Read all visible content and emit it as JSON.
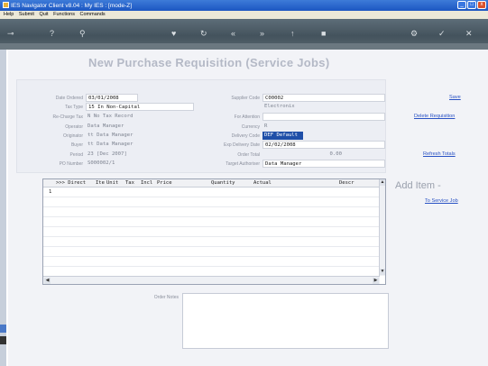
{
  "window": {
    "title": "IES Navigator Client v8.04 : My IES :     [mode-Z]",
    "controls": [
      "_",
      "□",
      "x"
    ]
  },
  "menu": [
    "Help",
    "Submit",
    "Quit",
    "Functions",
    "Commands"
  ],
  "toolbar_icons": [
    "key-icon",
    "help-icon",
    "search-icon",
    "heart-icon",
    "reload-icon",
    "back-icon",
    "forward-icon",
    "up-icon",
    "stop-icon",
    "settings-icon",
    "check-icon",
    "close-icon"
  ],
  "form": {
    "title": "New Purchase Requisition (Service Jobs)",
    "labels": {
      "date_ordered": "Date Ordered",
      "tax_type": "Tax Type",
      "recharge_tax": "Re-Charge Tax",
      "operator": "Operator",
      "originator": "Originator",
      "buyer": "Buyer",
      "period": "Period",
      "po_number": "PO Number",
      "supplier_code": "Supplier Code",
      "for_attention": "For Attention",
      "currency": "Currency",
      "delivery_code": "Delivery Code",
      "exp_delivery_date": "Exp Delivery Date",
      "order_total": "Order Total",
      "target_authoriser": "Target Authoriser"
    },
    "values": {
      "date_ordered": "03/01/2008",
      "tax_type": "15 In Non-Capital",
      "recharge_tax": "N No Tax Record",
      "operator": "Data Manager",
      "originator": "tt Data Manager",
      "buyer": "tt Data Manager",
      "period": "23  [Dec 2007]",
      "po_number": "S000002/1",
      "supplier_code": "C00002",
      "supplier_name": "Electronix",
      "for_attention": "",
      "currency": "R",
      "delivery_code": "DEF Default",
      "exp_delivery_date": "02/02/2008",
      "order_total": "0.00",
      "target_authoriser": "Data Manager"
    }
  },
  "actions": {
    "save": "Save",
    "delete": "Delete Requisition",
    "refresh": "Refresh Totals",
    "add_item": "Add Item -",
    "to_service_job": "To Service Job"
  },
  "grid": {
    "columns": [
      ">>> Direct",
      "Ite",
      "Unit",
      "Tax",
      "Incl",
      "Price",
      "Quantity",
      "Actual",
      "Descr"
    ],
    "rows": [
      {
        "num": "1"
      }
    ]
  },
  "notes": {
    "label": "Order Notes",
    "value": ""
  }
}
